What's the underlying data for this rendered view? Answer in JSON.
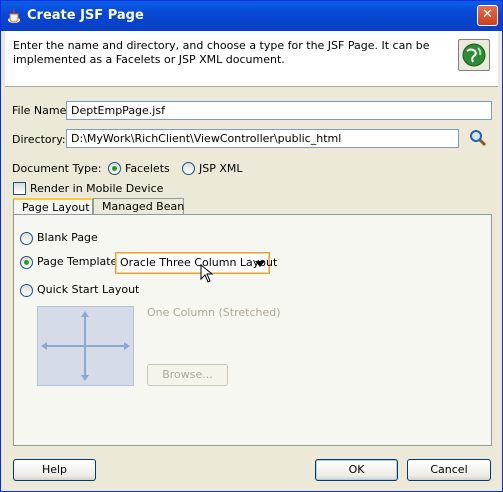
{
  "window": {
    "title": "Create JSF Page",
    "close_symbol": "✕",
    "icon": "java-cup-icon"
  },
  "header": {
    "instruction": "Enter the name and directory, and choose a type for the JSF Page. It can be implemented as a Facelets or JSP XML document.",
    "icon": "globe-icon"
  },
  "form": {
    "file_name_label": "File Name:",
    "file_name_value": "DeptEmpPage.jsf",
    "directory_label": "Directory:",
    "directory_value": "D:\\MyWork\\RichClient\\ViewController\\public_html",
    "document_type_label": "Document Type:",
    "document_type_options": [
      "Facelets",
      "JSP XML"
    ],
    "document_type_selected": "Facelets",
    "mobile_label": "Render in Mobile Device",
    "mobile_checked": false
  },
  "tabs": [
    "Page Layout",
    "Managed Bean"
  ],
  "active_tab": "Page Layout",
  "page_layout": {
    "blank_page_label": "Blank Page",
    "page_template_label": "Page Template",
    "template_selected": "Oracle Three Column Layout",
    "quick_start_label": "Quick Start Layout",
    "quick_start_name": "One Column (Stretched)",
    "browse_label": "Browse...",
    "selected_option": "Page Template"
  },
  "buttons": {
    "help": "Help",
    "ok": "OK",
    "cancel": "Cancel"
  },
  "colors": {
    "title_bar": "#0a5fe9",
    "dialog_bg": "#ece9d8",
    "radio_dot": "#21a121",
    "tab_highlight": "#ffc83c"
  }
}
